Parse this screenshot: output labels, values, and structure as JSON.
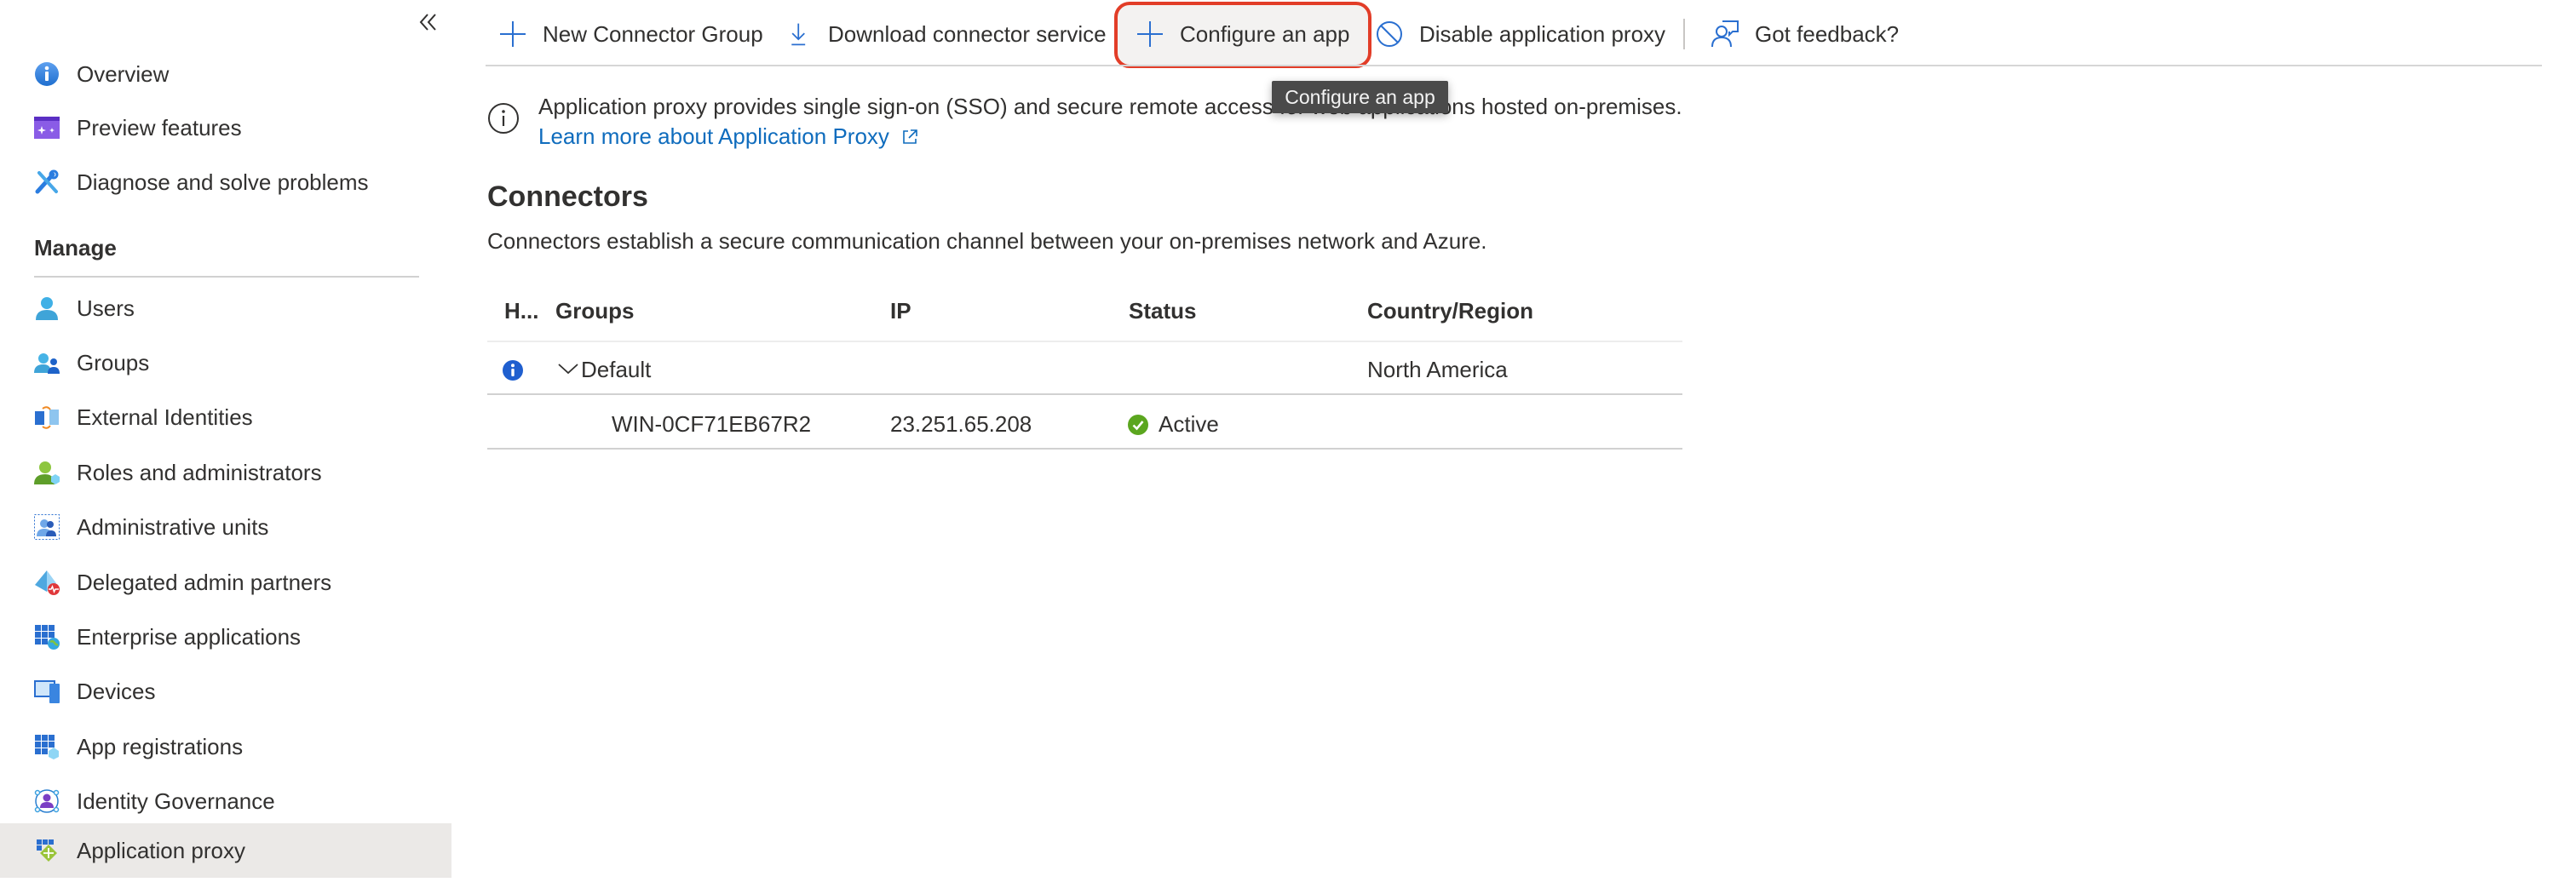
{
  "sidebar": {
    "collapse_label": "«",
    "top_items": [
      {
        "label": "Overview",
        "icon": "info-circle-icon"
      },
      {
        "label": "Preview features",
        "icon": "preview-features-icon"
      },
      {
        "label": "Diagnose and solve problems",
        "icon": "wrench-screwdriver-icon"
      }
    ],
    "manage_title": "Manage",
    "manage_items": [
      {
        "label": "Users",
        "icon": "user-icon"
      },
      {
        "label": "Groups",
        "icon": "groups-icon"
      },
      {
        "label": "External Identities",
        "icon": "external-identities-icon"
      },
      {
        "label": "Roles and administrators",
        "icon": "roles-icon"
      },
      {
        "label": "Administrative units",
        "icon": "administrative-units-icon"
      },
      {
        "label": "Delegated admin partners",
        "icon": "delegated-admin-icon"
      },
      {
        "label": "Enterprise applications",
        "icon": "enterprise-apps-icon"
      },
      {
        "label": "Devices",
        "icon": "devices-icon"
      },
      {
        "label": "App registrations",
        "icon": "app-registrations-icon"
      },
      {
        "label": "Identity Governance",
        "icon": "identity-governance-icon"
      },
      {
        "label": "Application proxy",
        "icon": "application-proxy-icon",
        "active": true
      }
    ]
  },
  "toolbar": {
    "new_connector_group": "New Connector Group",
    "download_connector_service": "Download connector service",
    "configure_app": "Configure an app",
    "disable_proxy": "Disable application proxy",
    "feedback": "Got feedback?"
  },
  "tooltip": {
    "text": "Configure an app"
  },
  "info": {
    "text": "Application proxy provides single sign-on (SSO) and secure remote access for web applications hosted on-premises.",
    "link": "Learn more about Application Proxy"
  },
  "connectors": {
    "title": "Connectors",
    "description": "Connectors establish a secure communication channel between your on-premises network and Azure.",
    "columns": [
      "H...",
      "Groups",
      "IP",
      "Status",
      "Country/Region"
    ],
    "groups": [
      {
        "name": "Default",
        "country_region": "North America",
        "expanded": true,
        "connectors": [
          {
            "name": "WIN-0CF71EB67R2",
            "ip": "23.251.65.208",
            "status": "Active"
          }
        ]
      }
    ]
  },
  "colors": {
    "accent": "#0f6cbd",
    "highlight_border": "#e23d28",
    "active_nav_bg": "#ebe9e7",
    "status_active": "#5ba61f"
  }
}
